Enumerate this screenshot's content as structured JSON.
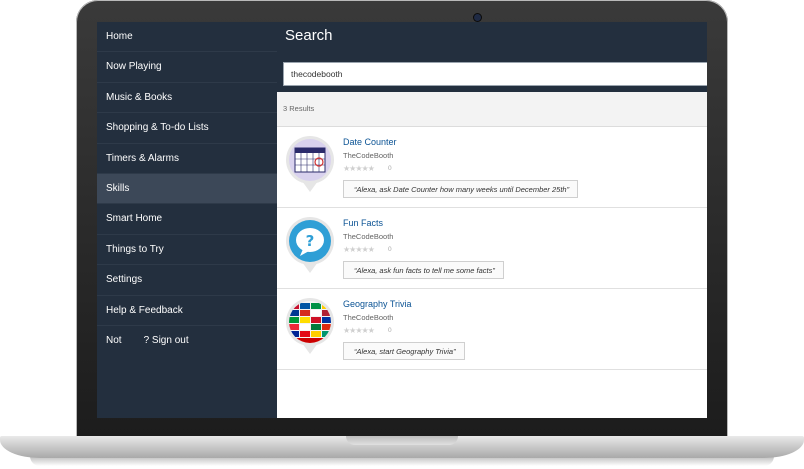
{
  "sidebar": {
    "items": [
      {
        "label": "Home"
      },
      {
        "label": "Now Playing"
      },
      {
        "label": "Music & Books"
      },
      {
        "label": "Shopping & To-do Lists"
      },
      {
        "label": "Timers & Alarms"
      },
      {
        "label": "Skills",
        "active": true
      },
      {
        "label": "Smart Home"
      },
      {
        "label": "Things to Try"
      },
      {
        "label": "Settings"
      },
      {
        "label": "Help & Feedback"
      }
    ],
    "signout": {
      "prefix": "Not",
      "label": "? Sign out"
    }
  },
  "header": {
    "title": "Search"
  },
  "search": {
    "value": "thecodebooth"
  },
  "results": {
    "count_label": "3 Results",
    "items": [
      {
        "name": "Date Counter",
        "developer": "TheCodeBooth",
        "rating_count": "0",
        "phrase": "“Alexa, ask Date Counter how many weeks until December 25th”",
        "icon": "calendar-icon"
      },
      {
        "name": "Fun Facts",
        "developer": "TheCodeBooth",
        "rating_count": "0",
        "phrase": "“Alexa, ask fun facts to tell me some facts”",
        "icon": "question-bubble-icon"
      },
      {
        "name": "Geography Trivia",
        "developer": "TheCodeBooth",
        "rating_count": "0",
        "phrase": "“Alexa, start Geography Trivia”",
        "icon": "flags-globe-icon"
      }
    ]
  },
  "colors": {
    "sidebar": "#232f3e",
    "active": "#3c4858",
    "link": "#0b5394"
  }
}
